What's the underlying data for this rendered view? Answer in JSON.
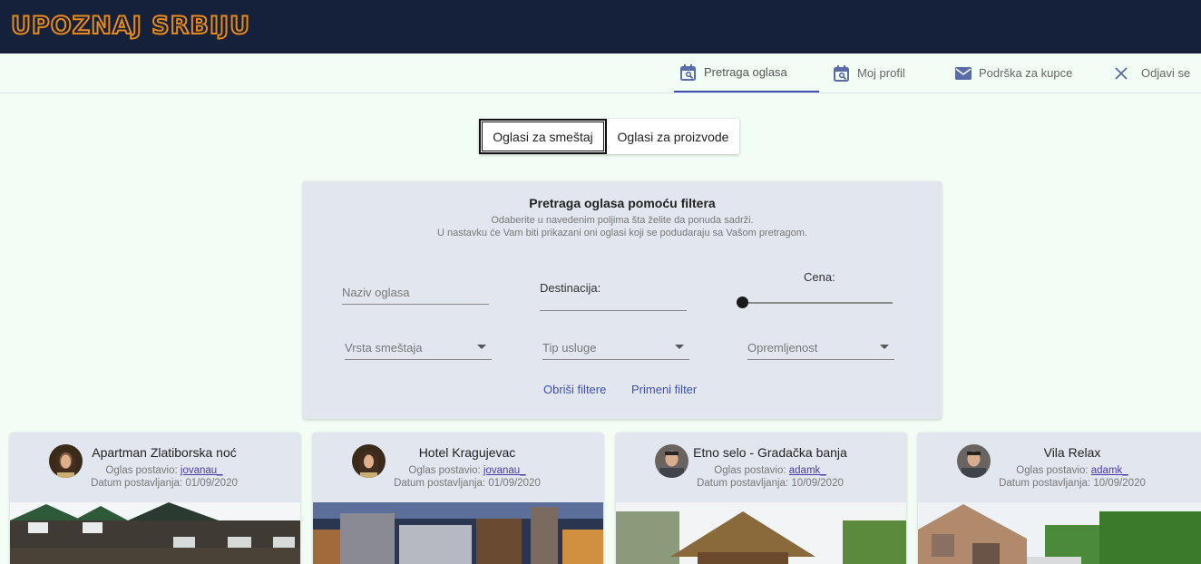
{
  "app": {
    "logo": "UPOZNAJ SRBIJU"
  },
  "nav": {
    "items": [
      {
        "label": "Pretraga oglasa",
        "icon": "calendar-search-icon",
        "active": true
      },
      {
        "label": "Moj profil",
        "icon": "calendar-search-icon",
        "active": false
      },
      {
        "label": "Podrška za kupce",
        "icon": "mail-icon",
        "active": false
      },
      {
        "label": "Odjavi se",
        "icon": "close-icon",
        "active": false
      }
    ]
  },
  "toggle": {
    "accommodation": "Oglasi za smeštaj",
    "products": "Oglasi za proizvode"
  },
  "filters": {
    "title": "Pretraga oglasa pomoću filtera",
    "subtitle1": "Odaberite u navedenim poljima šta želite da ponuda sadrži.",
    "subtitle2": "U nastavku će Vam biti prikazani oni oglasi koji se podudaraju sa Vašom pretragom.",
    "name_placeholder": "Naziv oglasa",
    "destination_label": "Destinacija:",
    "price_label": "Cena:",
    "price_value": 0,
    "accommodation_type": "Vrsta smeštaja",
    "service_type": "Tip usluge",
    "equipment": "Opremljenost",
    "clear_button": "Obriši filtere",
    "apply_button": "Primeni filter"
  },
  "cards": [
    {
      "title": "Apartman Zlatiborska noć",
      "posted_by_label": "Oglas postavio:",
      "author": "jovanau_",
      "date_label": "Datum postavljanja:",
      "date": "01/09/2020"
    },
    {
      "title": "Hotel Kragujevac",
      "posted_by_label": "Oglas postavio:",
      "author": "jovanau_",
      "date_label": "Datum postavljanja:",
      "date": "01/09/2020"
    },
    {
      "title": "Etno selo - Gradačka banja",
      "posted_by_label": "Oglas postavio:",
      "author": "adamk_",
      "date_label": "Datum postavljanja:",
      "date": "10/09/2020"
    },
    {
      "title": "Vila Relax",
      "posted_by_label": "Oglas postavio:",
      "author": "adamk_",
      "date_label": "Datum postavljanja:",
      "date": "10/09/2020"
    }
  ],
  "colors": {
    "header_bg": "#15203b",
    "logo": "#e88a19",
    "accent": "#3c4fb5",
    "page_bg": "#f2fdf5",
    "panel_bg": "#e2e6ee"
  }
}
